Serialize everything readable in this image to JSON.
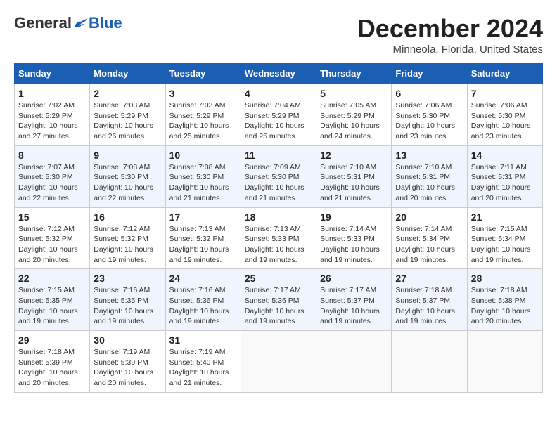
{
  "header": {
    "logo_general": "General",
    "logo_blue": "Blue",
    "title": "December 2024",
    "location": "Minneola, Florida, United States"
  },
  "calendar": {
    "days_of_week": [
      "Sunday",
      "Monday",
      "Tuesday",
      "Wednesday",
      "Thursday",
      "Friday",
      "Saturday"
    ],
    "weeks": [
      [
        {
          "day": "1",
          "sunrise": "7:02 AM",
          "sunset": "5:29 PM",
          "daylight": "10 hours and 27 minutes."
        },
        {
          "day": "2",
          "sunrise": "7:03 AM",
          "sunset": "5:29 PM",
          "daylight": "10 hours and 26 minutes."
        },
        {
          "day": "3",
          "sunrise": "7:03 AM",
          "sunset": "5:29 PM",
          "daylight": "10 hours and 25 minutes."
        },
        {
          "day": "4",
          "sunrise": "7:04 AM",
          "sunset": "5:29 PM",
          "daylight": "10 hours and 25 minutes."
        },
        {
          "day": "5",
          "sunrise": "7:05 AM",
          "sunset": "5:29 PM",
          "daylight": "10 hours and 24 minutes."
        },
        {
          "day": "6",
          "sunrise": "7:06 AM",
          "sunset": "5:30 PM",
          "daylight": "10 hours and 23 minutes."
        },
        {
          "day": "7",
          "sunrise": "7:06 AM",
          "sunset": "5:30 PM",
          "daylight": "10 hours and 23 minutes."
        }
      ],
      [
        {
          "day": "8",
          "sunrise": "7:07 AM",
          "sunset": "5:30 PM",
          "daylight": "10 hours and 22 minutes."
        },
        {
          "day": "9",
          "sunrise": "7:08 AM",
          "sunset": "5:30 PM",
          "daylight": "10 hours and 22 minutes."
        },
        {
          "day": "10",
          "sunrise": "7:08 AM",
          "sunset": "5:30 PM",
          "daylight": "10 hours and 21 minutes."
        },
        {
          "day": "11",
          "sunrise": "7:09 AM",
          "sunset": "5:30 PM",
          "daylight": "10 hours and 21 minutes."
        },
        {
          "day": "12",
          "sunrise": "7:10 AM",
          "sunset": "5:31 PM",
          "daylight": "10 hours and 21 minutes."
        },
        {
          "day": "13",
          "sunrise": "7:10 AM",
          "sunset": "5:31 PM",
          "daylight": "10 hours and 20 minutes."
        },
        {
          "day": "14",
          "sunrise": "7:11 AM",
          "sunset": "5:31 PM",
          "daylight": "10 hours and 20 minutes."
        }
      ],
      [
        {
          "day": "15",
          "sunrise": "7:12 AM",
          "sunset": "5:32 PM",
          "daylight": "10 hours and 20 minutes."
        },
        {
          "day": "16",
          "sunrise": "7:12 AM",
          "sunset": "5:32 PM",
          "daylight": "10 hours and 19 minutes."
        },
        {
          "day": "17",
          "sunrise": "7:13 AM",
          "sunset": "5:32 PM",
          "daylight": "10 hours and 19 minutes."
        },
        {
          "day": "18",
          "sunrise": "7:13 AM",
          "sunset": "5:33 PM",
          "daylight": "10 hours and 19 minutes."
        },
        {
          "day": "19",
          "sunrise": "7:14 AM",
          "sunset": "5:33 PM",
          "daylight": "10 hours and 19 minutes."
        },
        {
          "day": "20",
          "sunrise": "7:14 AM",
          "sunset": "5:34 PM",
          "daylight": "10 hours and 19 minutes."
        },
        {
          "day": "21",
          "sunrise": "7:15 AM",
          "sunset": "5:34 PM",
          "daylight": "10 hours and 19 minutes."
        }
      ],
      [
        {
          "day": "22",
          "sunrise": "7:15 AM",
          "sunset": "5:35 PM",
          "daylight": "10 hours and 19 minutes."
        },
        {
          "day": "23",
          "sunrise": "7:16 AM",
          "sunset": "5:35 PM",
          "daylight": "10 hours and 19 minutes."
        },
        {
          "day": "24",
          "sunrise": "7:16 AM",
          "sunset": "5:36 PM",
          "daylight": "10 hours and 19 minutes."
        },
        {
          "day": "25",
          "sunrise": "7:17 AM",
          "sunset": "5:36 PM",
          "daylight": "10 hours and 19 minutes."
        },
        {
          "day": "26",
          "sunrise": "7:17 AM",
          "sunset": "5:37 PM",
          "daylight": "10 hours and 19 minutes."
        },
        {
          "day": "27",
          "sunrise": "7:18 AM",
          "sunset": "5:37 PM",
          "daylight": "10 hours and 19 minutes."
        },
        {
          "day": "28",
          "sunrise": "7:18 AM",
          "sunset": "5:38 PM",
          "daylight": "10 hours and 20 minutes."
        }
      ],
      [
        {
          "day": "29",
          "sunrise": "7:18 AM",
          "sunset": "5:39 PM",
          "daylight": "10 hours and 20 minutes."
        },
        {
          "day": "30",
          "sunrise": "7:19 AM",
          "sunset": "5:39 PM",
          "daylight": "10 hours and 20 minutes."
        },
        {
          "day": "31",
          "sunrise": "7:19 AM",
          "sunset": "5:40 PM",
          "daylight": "10 hours and 21 minutes."
        },
        null,
        null,
        null,
        null
      ]
    ]
  }
}
